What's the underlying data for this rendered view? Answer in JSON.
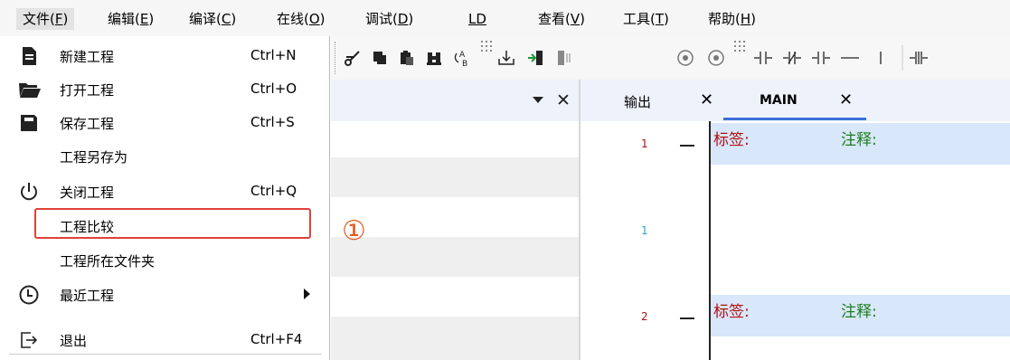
{
  "menubar": {
    "items": [
      {
        "text": "文件(",
        "acc": "F",
        "suffix": ")"
      },
      {
        "text": "编辑(",
        "acc": "E",
        "suffix": ")"
      },
      {
        "text": "编译(",
        "acc": "C",
        "suffix": ")"
      },
      {
        "text": "在线(",
        "acc": "O",
        "suffix": ")"
      },
      {
        "text": "调试(",
        "acc": "D",
        "suffix": ")"
      },
      {
        "text": "",
        "acc": "LD",
        "suffix": ""
      },
      {
        "text": "查看(",
        "acc": "V",
        "suffix": ")"
      },
      {
        "text": "工具(",
        "acc": "T",
        "suffix": ")"
      },
      {
        "text": "帮助(",
        "acc": "H",
        "suffix": ")"
      }
    ]
  },
  "file_menu": {
    "items": [
      {
        "label": "新建工程",
        "shortcut": "Ctrl+N",
        "icon": "new-document-icon"
      },
      {
        "label": "打开工程",
        "shortcut": "Ctrl+O",
        "icon": "folder-open-icon"
      },
      {
        "label": "保存工程",
        "shortcut": "Ctrl+S",
        "icon": "floppy-disk-icon"
      },
      {
        "label": "工程另存为",
        "shortcut": "",
        "icon": ""
      },
      {
        "label": "关闭工程",
        "shortcut": "Ctrl+Q",
        "icon": "power-icon"
      },
      {
        "label": "工程比较",
        "shortcut": "",
        "icon": ""
      },
      {
        "label": "工程所在文件夹",
        "shortcut": "",
        "icon": ""
      },
      {
        "label": "最近工程",
        "shortcut": "",
        "icon": "clock-icon",
        "submenu": true
      },
      {
        "label": "退出",
        "shortcut": "Ctrl+F4",
        "icon": "exit-icon"
      }
    ],
    "highlighted_item": "工程比较"
  },
  "annotation": {
    "marker": "①",
    "color": "#e0413a"
  },
  "tabs": [
    {
      "label": "输出",
      "active": false
    },
    {
      "label": "MAIN",
      "active": true
    }
  ],
  "ladder": {
    "rungs": [
      {
        "number": "1",
        "label": "标签:",
        "comment": "注释:"
      },
      {
        "number": "1",
        "label": "",
        "comment": ""
      },
      {
        "number": "2",
        "label": "标签:",
        "comment": "注释:"
      }
    ]
  },
  "colors": {
    "accent": "#3a6fd8",
    "rung_highlight": "#d9e7fa",
    "label_color": "#b01010",
    "comment_color": "#1a7f1a",
    "marker_color": "#e45a1c"
  }
}
